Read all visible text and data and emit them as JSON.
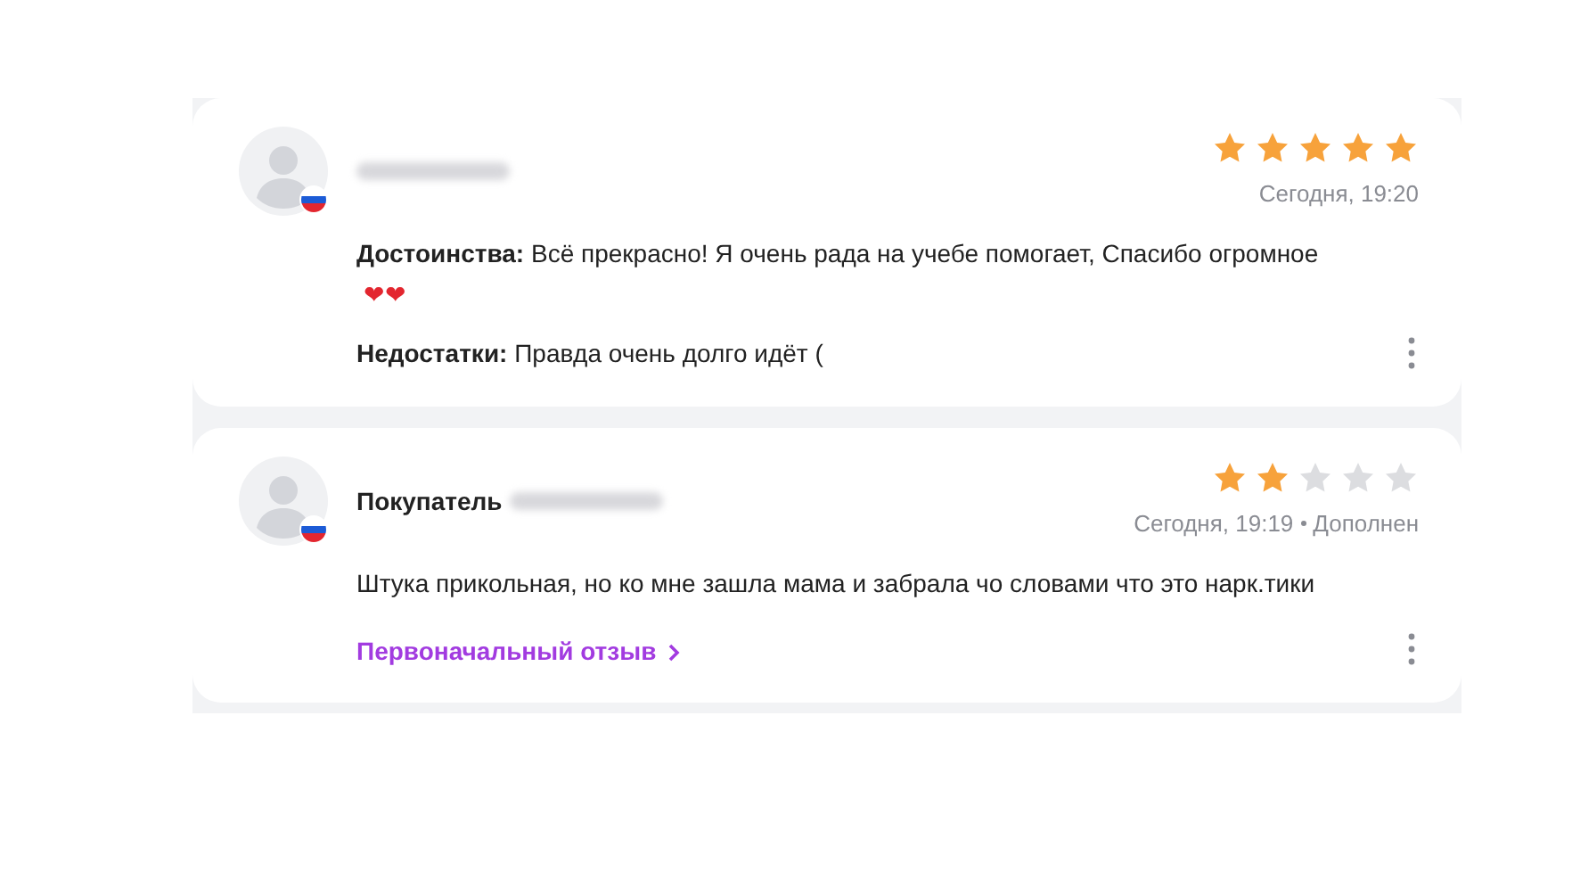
{
  "reviews": [
    {
      "author_redacted": true,
      "stars": 5,
      "date": "Сегодня, 19:20",
      "paragraphs": [
        {
          "text": "**Достоинства:** Всё прекрасно! Я очень рада на учебе помогает, Спасибо огромное",
          "hearts": "❤❤"
        },
        {
          "text": "**Недостатки:** Правда очень долго идёт ("
        }
      ]
    },
    {
      "author_prefix": "Покупатель",
      "author_redacted": true,
      "stars": 2,
      "date": "Сегодня, 19:19",
      "status": "Дополнен",
      "paragraphs": [
        {
          "text": "Штука прикольная, но ко мне зашла мама и забрала чо словами что это нарк.тики"
        }
      ],
      "link": "Первоначальный отзыв"
    }
  ]
}
